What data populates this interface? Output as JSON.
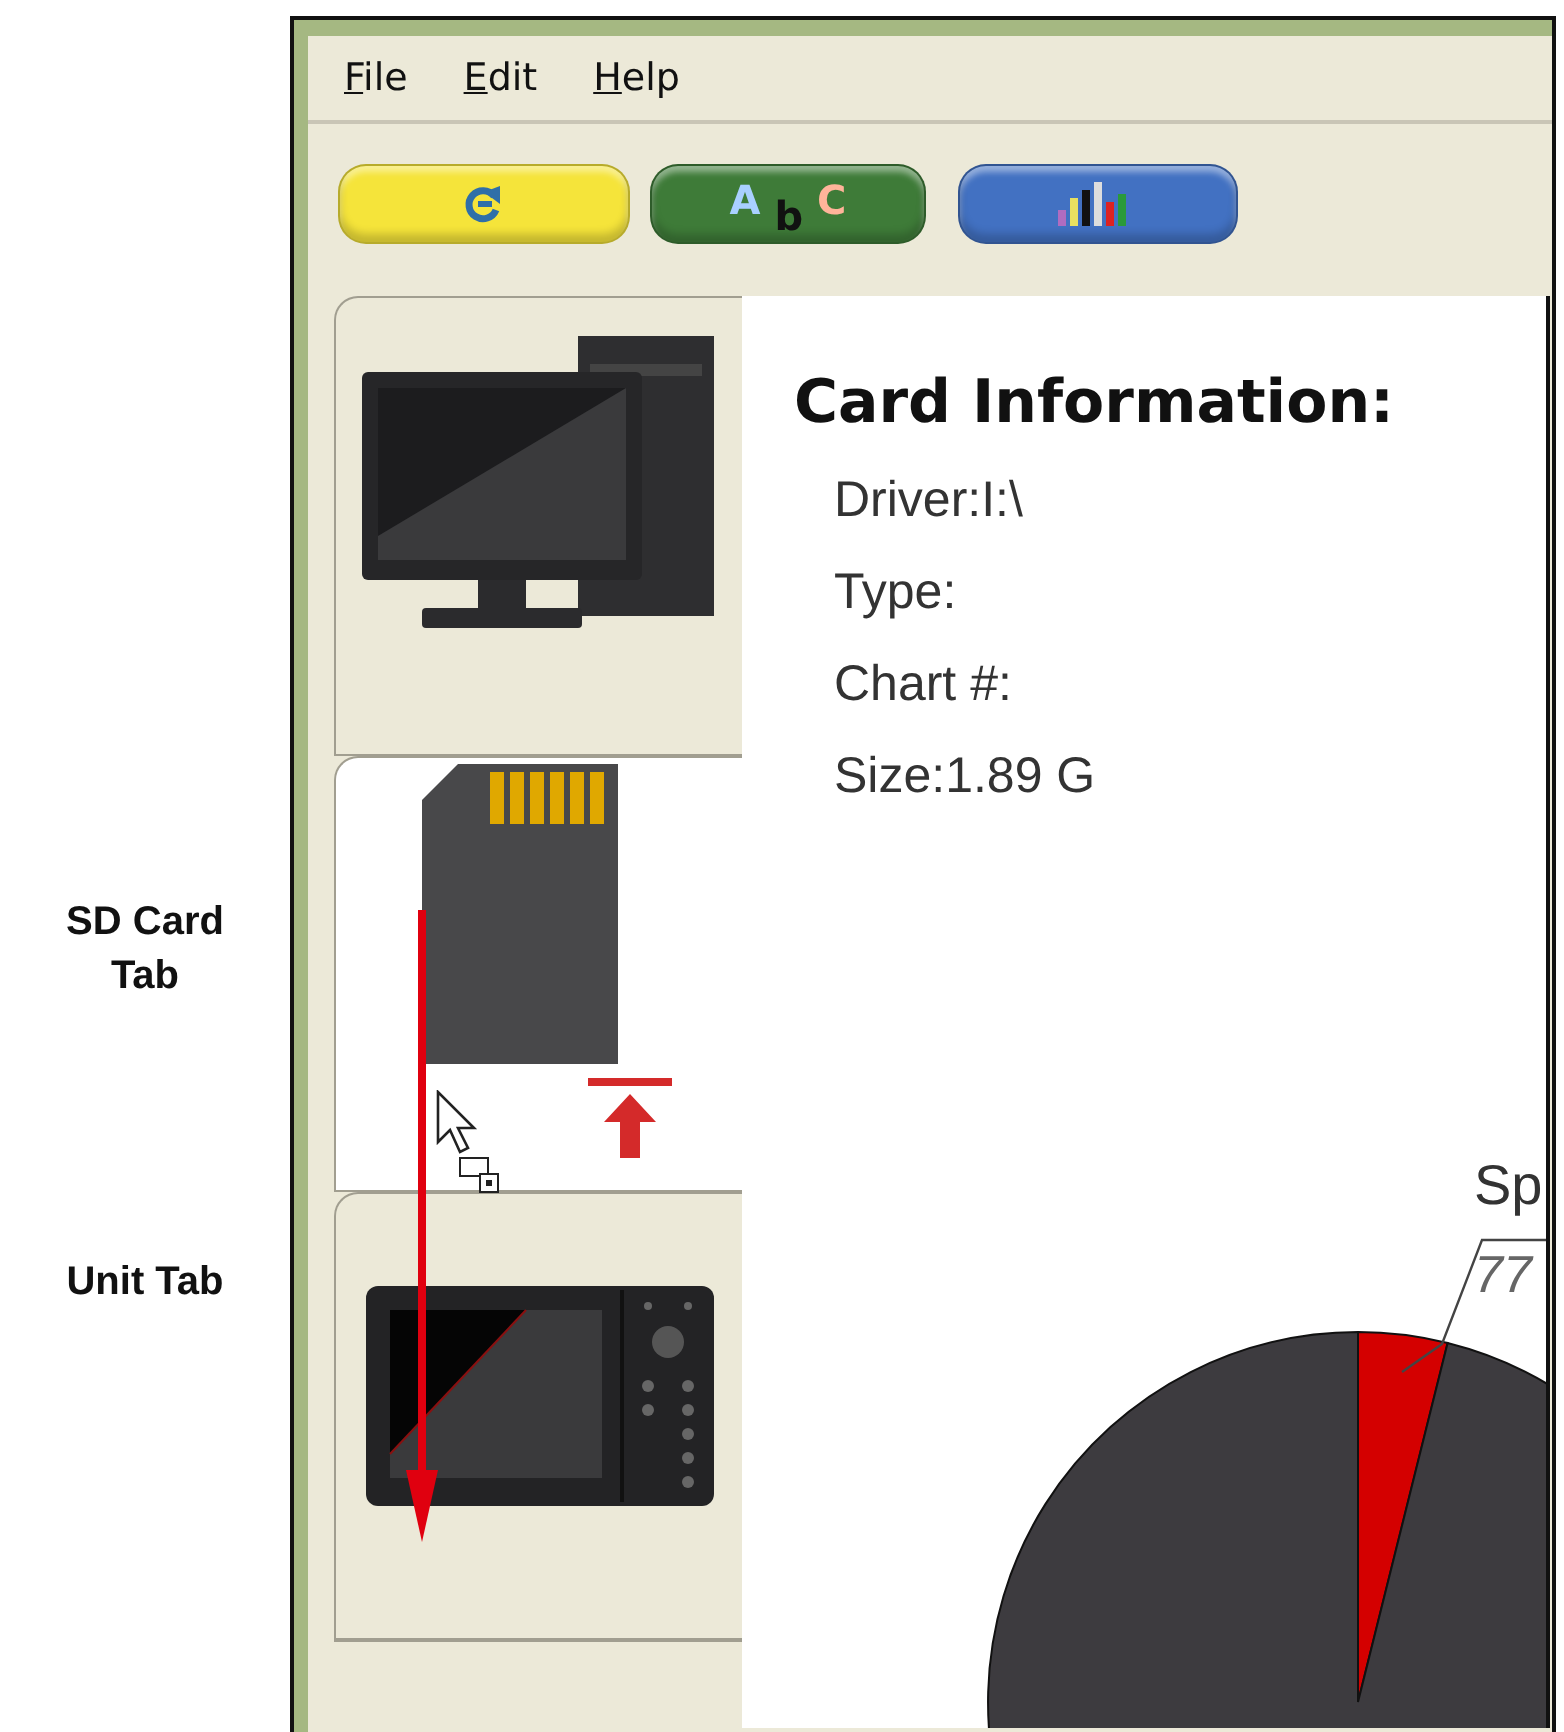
{
  "menu": [
    {
      "label": "File"
    },
    {
      "label": "Edit"
    },
    {
      "label": "Help"
    }
  ],
  "toolbar": [
    {
      "kind": "refresh"
    },
    {
      "kind": "text",
      "label": "A b C"
    },
    {
      "kind": "chart"
    }
  ],
  "sidebar": {
    "tabs": [
      {
        "kind": "computer",
        "selected": false
      },
      {
        "kind": "sd-card",
        "selected": true
      },
      {
        "kind": "unit",
        "selected": false
      }
    ]
  },
  "card_info": {
    "title": "Card Information:",
    "lines": [
      "Driver:I:\\",
      "Type:",
      "Chart #:",
      "Size:1.89 G"
    ]
  },
  "pie": {
    "label": "Sp",
    "value": "77"
  },
  "annotations": [
    "SD Card Tab",
    "Unit Tab"
  ]
}
